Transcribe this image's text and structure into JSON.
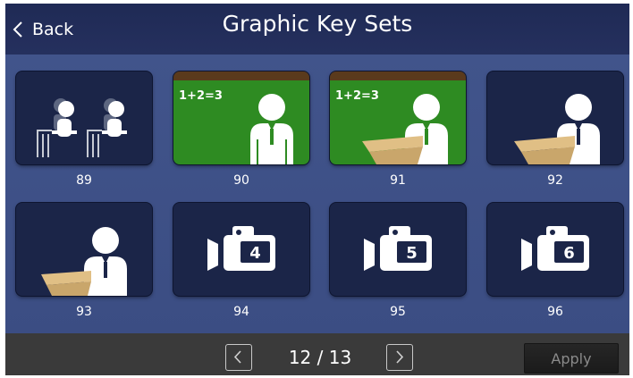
{
  "header": {
    "back_label": "Back",
    "title": "Graphic Key Sets"
  },
  "keys": [
    {
      "number": "89",
      "icon": "seated-students-icon"
    },
    {
      "number": "90",
      "icon": "teacher-blackboard-icon",
      "board_text": "1+2=3"
    },
    {
      "number": "91",
      "icon": "teacher-blackboard-podium-icon",
      "board_text": "1+2=3"
    },
    {
      "number": "92",
      "icon": "speaker-podium-icon"
    },
    {
      "number": "93",
      "icon": "speaker-podium-side-icon"
    },
    {
      "number": "94",
      "icon": "camera-icon",
      "camera_number": "4"
    },
    {
      "number": "95",
      "icon": "camera-icon",
      "camera_number": "5"
    },
    {
      "number": "96",
      "icon": "camera-icon",
      "camera_number": "6"
    }
  ],
  "footer": {
    "page_indicator": "12 / 13",
    "apply_label": "Apply"
  },
  "colors": {
    "header": "#1f2a55",
    "background": "#3d4f86",
    "tile": "#1b2548",
    "board": "#2e8b22",
    "podium": "#c9a66b",
    "footer": "#3a3a3a"
  }
}
